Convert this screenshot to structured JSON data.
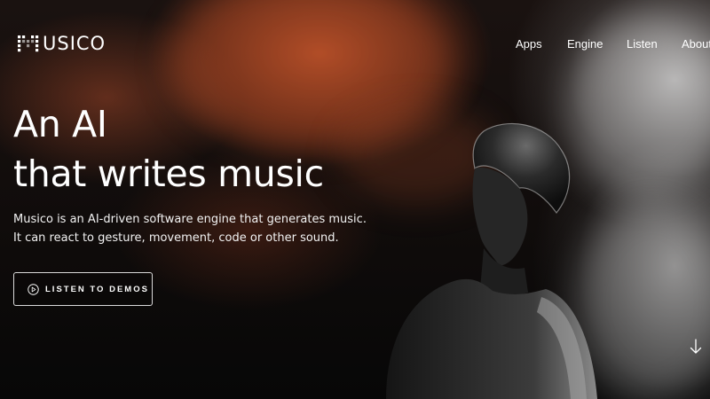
{
  "brand": {
    "name": "USICO",
    "logo_icon": "musico-dots-m-logo"
  },
  "nav": {
    "items": [
      {
        "label": "Apps"
      },
      {
        "label": "Engine"
      },
      {
        "label": "Listen"
      },
      {
        "label": "About"
      }
    ]
  },
  "hero": {
    "headline_line1": "An AI",
    "headline_line2": "that writes music",
    "subtitle_line1": "Musico is an AI-driven software engine that generates music.",
    "subtitle_line2": "It can react to gesture, movement, code or other sound.",
    "cta_label": "LISTEN TO DEMOS",
    "cta_icon": "play-circle-icon",
    "scroll_icon": "arrow-down-icon",
    "image": "person-in-smoke-photo"
  },
  "colors": {
    "text": "#ffffff",
    "smoke_orange": "#be5028",
    "smoke_grey": "#d7d7d7",
    "background": "#0a0908"
  }
}
